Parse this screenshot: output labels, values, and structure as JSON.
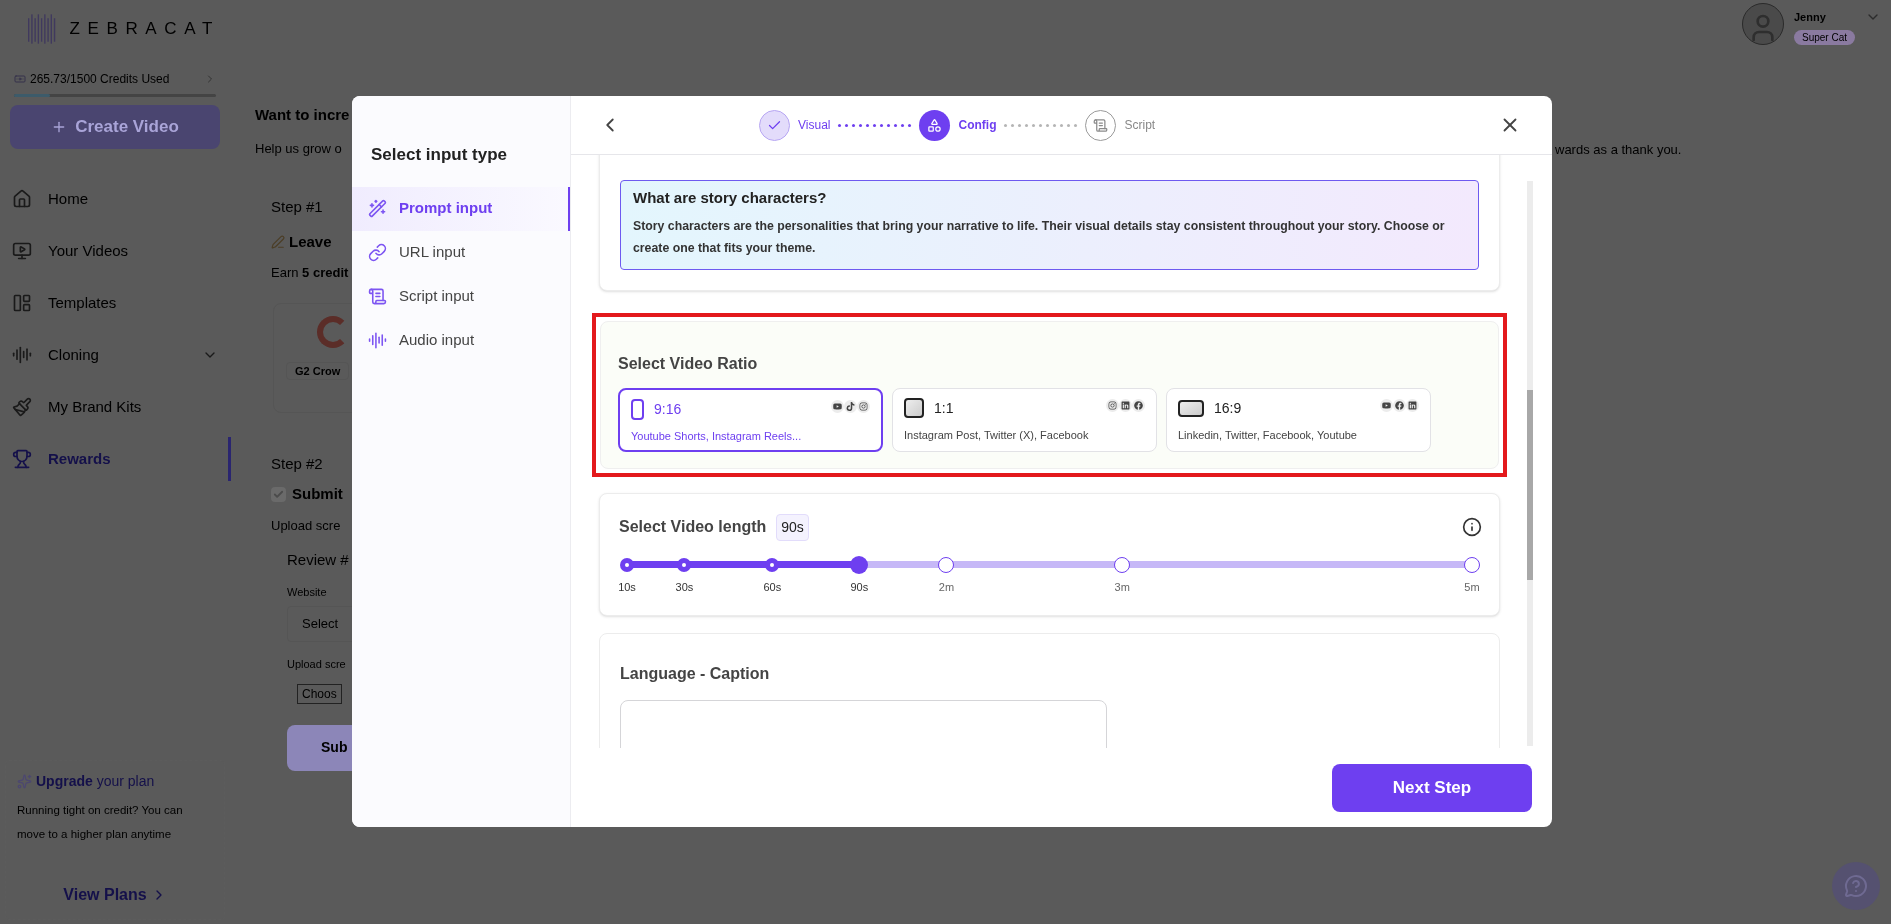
{
  "sidebar": {
    "logo": "ZEBRACAT",
    "credits": {
      "text": "265.73/1500 Credits Used",
      "level": 0.18
    },
    "create_button": "Create Video",
    "nav": [
      {
        "label": "Home",
        "selected": false,
        "expandable": false
      },
      {
        "label": "Your Videos",
        "selected": false,
        "expandable": false
      },
      {
        "label": "Templates",
        "selected": false,
        "expandable": false
      },
      {
        "label": "Cloning",
        "selected": false,
        "expandable": true
      },
      {
        "label": "My Brand Kits",
        "selected": false,
        "expandable": false
      },
      {
        "label": "Rewards",
        "selected": true,
        "expandable": false
      }
    ],
    "upgrade": {
      "title": "**Upgrade** your plan",
      "text": "Running tight on credit? You can move to a higher plan anytime",
      "link": "View Plans"
    }
  },
  "user": {
    "name": "Jenny",
    "badge": "Super Cat"
  },
  "background": {
    "heading": "Want to incre",
    "subheading": "Help us grow o",
    "subheading_end": "wards as a thank you.",
    "step1": {
      "label": "Step #1",
      "title": "Leave",
      "text": "Earn **5 credit**",
      "chip": "G2 Crow"
    },
    "step2": {
      "label": "Step #2",
      "checked": true,
      "title": "Submit",
      "text": "Upload scre",
      "review": "Review #",
      "website_label": "Website",
      "website_value": "Select",
      "upload_label": "Upload scre",
      "choose_button": "Choos",
      "submit_button": "Sub"
    }
  },
  "modal": {
    "sidebar_title": "Select input type",
    "input_types": [
      {
        "label": "Prompt input",
        "selected": true
      },
      {
        "label": "URL input",
        "selected": false
      },
      {
        "label": "Script input",
        "selected": false
      },
      {
        "label": "Audio input",
        "selected": false
      }
    ],
    "steps": [
      {
        "label": "Visual",
        "completed": true,
        "selected": false
      },
      {
        "label": "Config",
        "completed": false,
        "selected": true
      },
      {
        "label": "Script",
        "completed": false,
        "selected": false
      }
    ],
    "info": {
      "title": "What are story characters?",
      "text": "Story characters are the personalities that bring your narrative to life. Their visual details stay consistent throughout your story. Choose or create one that fits your theme."
    },
    "ratio": {
      "title": "Select Video Ratio",
      "highlighted": true,
      "options": [
        {
          "ratio": "9:16",
          "description": "Youtube Shorts, Instagram Reels...",
          "kind": "portrait",
          "selected": true
        },
        {
          "ratio": "1:1",
          "description": "Instagram Post, Twitter (X), Facebook",
          "kind": "square",
          "selected": false
        },
        {
          "ratio": "16:9",
          "description": "Linkedin, Twitter, Facebook, Youtube",
          "kind": "landscape",
          "selected": false
        }
      ]
    },
    "length": {
      "title": "Select Video length",
      "value": "90s",
      "level": 0.275,
      "stops": [
        {
          "label": "10s",
          "selected": false
        },
        {
          "label": "30s",
          "selected": false
        },
        {
          "label": "60s",
          "selected": false
        },
        {
          "label": "90s",
          "selected": true
        },
        {
          "label": "2m",
          "selected": false
        },
        {
          "label": "3m",
          "selected": false
        },
        {
          "label": "5m",
          "selected": false
        }
      ]
    },
    "language": {
      "title": "Language - Caption"
    },
    "next_button": "Next Step"
  }
}
